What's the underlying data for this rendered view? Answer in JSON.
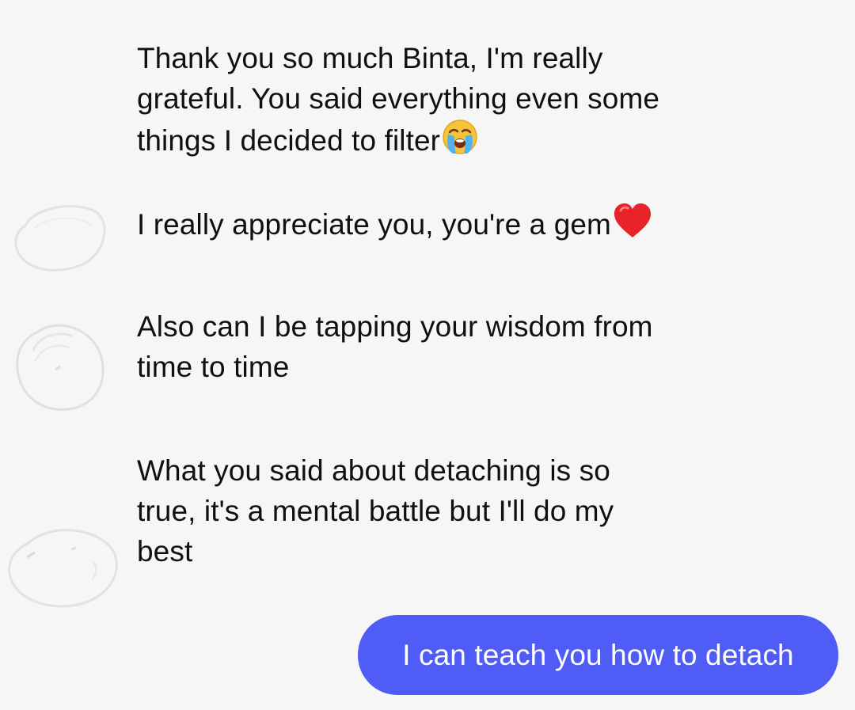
{
  "messages_incoming": [
    {
      "lines": [
        "Thank you so much Binta, I'm really",
        "grateful. You said everything even some",
        "things I decided to filter"
      ],
      "emoji": "crying-face"
    },
    {
      "lines": [
        "I really appreciate you, you're a gem"
      ],
      "emoji": "red-heart"
    },
    {
      "lines": [
        "Also can I be tapping your wisdom from",
        "time to time"
      ]
    },
    {
      "lines": [
        "What you said about detaching is so",
        "true, it's a mental battle but I'll do my",
        "best"
      ]
    }
  ],
  "messages_outgoing": [
    {
      "text": "I can teach you how to detach"
    }
  ],
  "colors": {
    "background": "#f6f6f6",
    "outgoing_bubble": "#4f5cf6",
    "incoming_text": "#101010",
    "outgoing_text": "#ffffff"
  },
  "icons": {
    "sender_avatar": "redacted-avatar",
    "emoji_1": "crying-face-emoji",
    "emoji_2": "red-heart-emoji"
  }
}
